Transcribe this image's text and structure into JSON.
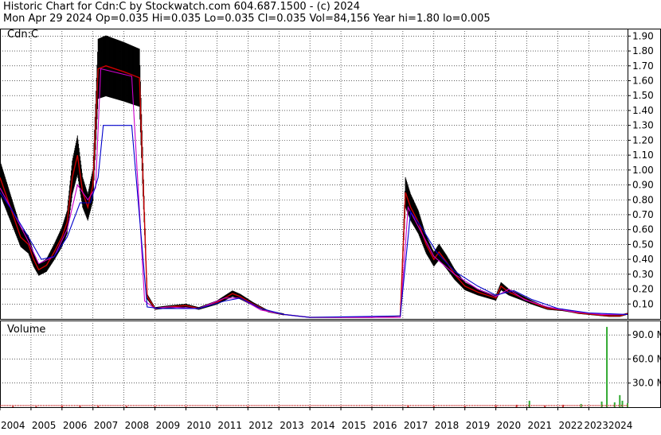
{
  "header": {
    "line1": "Historic Chart for Cdn:C by Stockwatch.com 604.687.1500 - (c) 2024",
    "line2": "Mon Apr 29 2024  Op=0.035  Hi=0.035  Lo=0.035  Cl=0.035  Vol=84,156  Year hi=1.80  lo=0.005"
  },
  "symbol_label": "Cdn:C",
  "volume_label": "Volume",
  "colors": {
    "price_bars": "#000000",
    "close_red": "#cc0000",
    "ma_short": "#cc00cc",
    "ma_long": "#0000cc",
    "volume_bars": "#33aa33",
    "volume_bars_red": "#cc3333",
    "grid": "#000000",
    "background": "#ffffff"
  },
  "chart_data": [
    {
      "type": "line",
      "title": "",
      "ylabel": "",
      "ylim": [
        0,
        1.95
      ],
      "grid": true,
      "y_ticks": [
        "1.90",
        "1.80",
        "1.70",
        "1.60",
        "1.50",
        "1.40",
        "1.30",
        "1.20",
        "1.10",
        "1.00",
        "0.90",
        "0.80",
        "0.70",
        "0.60",
        "0.50",
        "0.40",
        "0.30",
        "0.20",
        "0.10"
      ],
      "x_ticks": [
        "2004",
        "2005",
        "2006",
        "2007",
        "2008",
        "2009",
        "2010",
        "2011",
        "2012",
        "2013",
        "2014",
        "2015",
        "2016",
        "2017",
        "2018",
        "2019",
        "2020",
        "2021",
        "2022",
        "20232024"
      ],
      "x_range": [
        "2004-01",
        "2024-04"
      ],
      "series": [
        {
          "role": "price_close",
          "x": [
            "2004-01",
            "2004-03",
            "2004-06",
            "2004-09",
            "2004-12",
            "2005-02",
            "2005-04",
            "2005-07",
            "2005-10",
            "2006-01",
            "2006-03",
            "2006-05",
            "2006-07",
            "2006-09",
            "2006-11",
            "2007-01",
            "2007-03",
            "2007-06",
            "2008-01",
            "2008-04",
            "2008-07",
            "2008-10",
            "2009-01",
            "2009-06",
            "2010-01",
            "2010-06",
            "2011-01",
            "2011-04",
            "2011-07",
            "2011-10",
            "2012-03",
            "2012-09",
            "2013-03",
            "2014-01",
            "2015-01",
            "2016-01",
            "2016-12",
            "2017-02",
            "2017-04",
            "2017-07",
            "2017-10",
            "2018-01",
            "2018-03",
            "2018-06",
            "2018-09",
            "2019-01",
            "2019-06",
            "2020-01",
            "2020-03",
            "2020-06",
            "2020-10",
            "2021-03",
            "2021-09",
            "2022-03",
            "2022-09",
            "2023-03",
            "2023-09",
            "2024-01",
            "2024-04"
          ],
          "y": [
            0.95,
            0.85,
            0.7,
            0.55,
            0.5,
            0.4,
            0.33,
            0.36,
            0.45,
            0.55,
            0.65,
            0.95,
            1.1,
            0.85,
            0.75,
            0.9,
            1.68,
            1.7,
            1.66,
            1.64,
            1.62,
            0.15,
            0.07,
            0.08,
            0.09,
            0.07,
            0.11,
            0.14,
            0.17,
            0.15,
            0.1,
            0.05,
            0.03,
            0.01,
            0.01,
            0.01,
            0.02,
            0.85,
            0.75,
            0.65,
            0.5,
            0.4,
            0.45,
            0.38,
            0.3,
            0.22,
            0.18,
            0.14,
            0.22,
            0.18,
            0.15,
            0.11,
            0.07,
            0.06,
            0.04,
            0.03,
            0.02,
            0.02,
            0.035
          ]
        },
        {
          "role": "moving_average_short",
          "x": [
            "2004-01",
            "2004-06",
            "2004-12",
            "2005-04",
            "2005-10",
            "2006-03",
            "2006-07",
            "2006-11",
            "2007-02",
            "2007-04",
            "2008-04",
            "2008-09",
            "2009-01",
            "2009-06",
            "2010-06",
            "2011-04",
            "2011-10",
            "2012-06",
            "2013-03",
            "2014-01",
            "2016-12",
            "2017-03",
            "2017-07",
            "2018-01",
            "2018-09",
            "2019-06",
            "2020-01",
            "2020-06",
            "2020-12",
            "2021-09",
            "2022-06",
            "2023-06",
            "2024-04"
          ],
          "y": [
            0.88,
            0.72,
            0.52,
            0.37,
            0.42,
            0.6,
            0.9,
            0.8,
            0.88,
            1.68,
            1.63,
            0.12,
            0.07,
            0.08,
            0.07,
            0.14,
            0.14,
            0.06,
            0.03,
            0.01,
            0.01,
            0.75,
            0.62,
            0.42,
            0.3,
            0.2,
            0.15,
            0.2,
            0.13,
            0.08,
            0.05,
            0.03,
            0.03
          ]
        },
        {
          "role": "moving_average_long",
          "x": [
            "2004-01",
            "2004-06",
            "2004-12",
            "2005-05",
            "2005-10",
            "2006-03",
            "2006-08",
            "2006-12",
            "2007-03",
            "2007-05",
            "2008-04",
            "2008-10",
            "2009-03",
            "2010-06",
            "2011-04",
            "2011-10",
            "2012-06",
            "2013-03",
            "2014-01",
            "2016-12",
            "2017-04",
            "2017-08",
            "2018-02",
            "2018-09",
            "2019-06",
            "2020-01",
            "2020-08",
            "2021-03",
            "2022-01",
            "2023-01",
            "2024-04"
          ],
          "y": [
            0.85,
            0.72,
            0.55,
            0.4,
            0.42,
            0.55,
            0.78,
            0.78,
            0.95,
            1.3,
            1.3,
            0.08,
            0.07,
            0.07,
            0.12,
            0.14,
            0.07,
            0.03,
            0.01,
            0.02,
            0.72,
            0.62,
            0.45,
            0.32,
            0.22,
            0.16,
            0.19,
            0.13,
            0.07,
            0.04,
            0.03
          ]
        }
      ]
    },
    {
      "type": "bar",
      "title": "Volume",
      "ylim": [
        0,
        108
      ],
      "y_ticks": [
        "90.0 M",
        "60.0 M",
        "30.0 M"
      ],
      "x": [
        "2004-06",
        "2005-03",
        "2006-01",
        "2006-08",
        "2007-03",
        "2008-02",
        "2009-01",
        "2010-01",
        "2011-01",
        "2012-01",
        "2013-01",
        "2014-01",
        "2015-01",
        "2016-01",
        "2017-03",
        "2018-01",
        "2019-01",
        "2020-01",
        "2020-09",
        "2021-02",
        "2021-08",
        "2022-03",
        "2022-10",
        "2023-06",
        "2023-08",
        "2023-11",
        "2024-01",
        "2024-02",
        "2024-04"
      ],
      "values": [
        1.5,
        1.2,
        2,
        1.8,
        1.6,
        1.3,
        1,
        0.8,
        1.2,
        0.9,
        0.6,
        0.5,
        0.4,
        0.4,
        1.8,
        1.5,
        1.4,
        2.5,
        3,
        8,
        2,
        3,
        4,
        7,
        100,
        6,
        15,
        8,
        5
      ]
    }
  ]
}
